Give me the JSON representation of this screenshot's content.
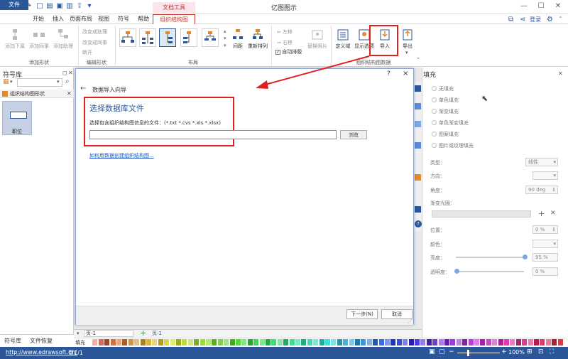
{
  "app": {
    "title": "亿图图示",
    "tool_tab": "文档工具",
    "login": "登录"
  },
  "menu": [
    "文件",
    "开始",
    "插入",
    "页面布局",
    "视图",
    "符号",
    "帮助",
    "组织结构图"
  ],
  "ribbon": {
    "add_shapes": {
      "label": "添加形状",
      "buttons": [
        "添加下属",
        "添加同事",
        "添加助理"
      ]
    },
    "edit_shapes": {
      "label": "编辑形状",
      "items": [
        "改变成助理",
        "改变成同事",
        "断开"
      ]
    },
    "layout": {
      "label": "布局",
      "spacing": "间距",
      "relayout": "重新排列"
    },
    "move": {
      "left": "左移",
      "right": "右移",
      "auto_layout": "自动排版",
      "replace_photo": "替换照片"
    },
    "org_data": {
      "label": "组织结构图数据",
      "define_field": "定义域",
      "show_options": "显示选项",
      "import": "导入",
      "export": "导出"
    }
  },
  "left_panel": {
    "title": "符号库",
    "category": "组织结构图形状",
    "tile_label": "职位",
    "tabs": [
      "符号库",
      "文件恢复"
    ]
  },
  "dialog": {
    "help": "?",
    "close": "×",
    "back": "←",
    "title": "数据导入向导",
    "heading": "选择数据库文件",
    "description": "选择包含组织结构图信息的文件：(*.txt  *.cvs  *.xls  *.xlsx)",
    "path_value": "",
    "browse": "浏览",
    "help_link": "如何用数据创建组织结构图...",
    "next": "下一步(N)",
    "cancel": "取消"
  },
  "right_panel": {
    "title": "填充",
    "fill_options": [
      "无填充",
      "单色填充",
      "渐变填充",
      "单色渐变填充",
      "图案填充",
      "图片或纹理填充"
    ],
    "type_label": "类型：",
    "type_value": "线性",
    "direction_label": "方向：",
    "angle_label": "角度：",
    "angle_value": "90 deg",
    "gradient_label": "渐变光圈：",
    "position_label": "位置：",
    "position_value": "0 %",
    "color_label": "颜色：",
    "brightness_label": "亮度：",
    "brightness_value": "95 %",
    "transparency_label": "透明度：",
    "transparency_value": "0 %"
  },
  "pagebar": {
    "page_select": "页-1",
    "page_tab": "页-1",
    "fill_label": "填充"
  },
  "status": {
    "url": "http://www.edrawsoft.cn/",
    "page": "页1/1",
    "zoom": "100%"
  },
  "colors": {
    "accent": "#2b579a",
    "highlight": "#e0201e",
    "tool_tab_bg": "#fce4ec"
  }
}
